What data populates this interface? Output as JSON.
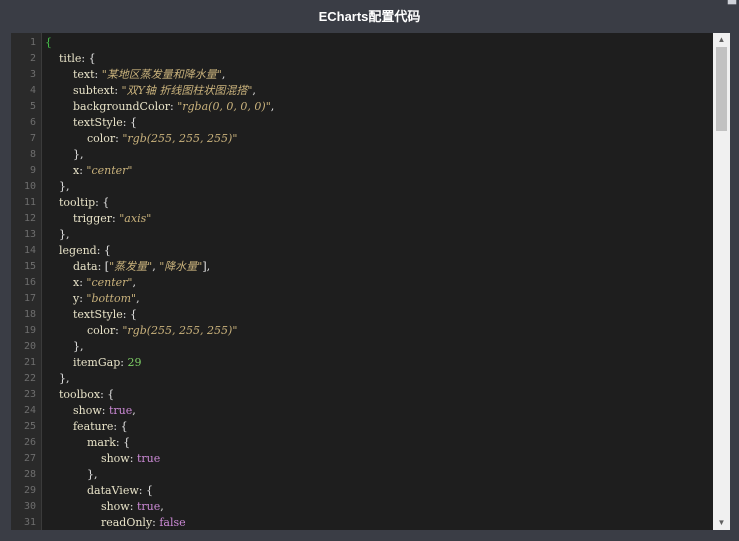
{
  "window": {
    "title": "ECharts配置代码",
    "close_glyph": "▀"
  },
  "editor": {
    "line_numbers": [
      "1",
      "2",
      "3",
      "4",
      "5",
      "6",
      "7",
      "8",
      "9",
      "10",
      "11",
      "12",
      "13",
      "14",
      "15",
      "16",
      "17",
      "18",
      "19",
      "20",
      "21",
      "22",
      "23",
      "24",
      "25",
      "26",
      "27",
      "28",
      "29",
      "30",
      "31"
    ],
    "lines": [
      [
        [
          "{",
          "brace0"
        ]
      ],
      [
        [
          "    ",
          ""
        ],
        [
          "title",
          "key"
        ],
        [
          ": {",
          "punc"
        ]
      ],
      [
        [
          "        ",
          ""
        ],
        [
          "text",
          "key"
        ],
        [
          ": ",
          "punc"
        ],
        [
          "\"某地区蒸发量和降水量\"",
          "str"
        ],
        [
          ",",
          "punc"
        ]
      ],
      [
        [
          "        ",
          ""
        ],
        [
          "subtext",
          "key"
        ],
        [
          ": ",
          "punc"
        ],
        [
          "\"双Y轴 折线图柱状图混搭\"",
          "str"
        ],
        [
          ",",
          "punc"
        ]
      ],
      [
        [
          "        ",
          ""
        ],
        [
          "backgroundColor",
          "key"
        ],
        [
          ": ",
          "punc"
        ],
        [
          "\"rgba(0, 0, 0, 0)\"",
          "str"
        ],
        [
          ",",
          "punc"
        ]
      ],
      [
        [
          "        ",
          ""
        ],
        [
          "textStyle",
          "key"
        ],
        [
          ": {",
          "punc"
        ]
      ],
      [
        [
          "            ",
          ""
        ],
        [
          "color",
          "key"
        ],
        [
          ": ",
          "punc"
        ],
        [
          "\"rgb(255, 255, 255)\"",
          "str"
        ]
      ],
      [
        [
          "        },",
          "punc"
        ]
      ],
      [
        [
          "        ",
          ""
        ],
        [
          "x",
          "key"
        ],
        [
          ": ",
          "punc"
        ],
        [
          "\"center\"",
          "str"
        ]
      ],
      [
        [
          "    },",
          "punc"
        ]
      ],
      [
        [
          "    ",
          ""
        ],
        [
          "tooltip",
          "key"
        ],
        [
          ": {",
          "punc"
        ]
      ],
      [
        [
          "        ",
          ""
        ],
        [
          "trigger",
          "key"
        ],
        [
          ": ",
          "punc"
        ],
        [
          "\"axis\"",
          "str"
        ]
      ],
      [
        [
          "    },",
          "punc"
        ]
      ],
      [
        [
          "    ",
          ""
        ],
        [
          "legend",
          "key"
        ],
        [
          ": {",
          "punc"
        ]
      ],
      [
        [
          "        ",
          ""
        ],
        [
          "data",
          "key"
        ],
        [
          ": [",
          "punc"
        ],
        [
          "\"蒸发量\"",
          "str"
        ],
        [
          ", ",
          "punc"
        ],
        [
          "\"降水量\"",
          "str"
        ],
        [
          "],",
          "punc"
        ]
      ],
      [
        [
          "        ",
          ""
        ],
        [
          "x",
          "key"
        ],
        [
          ": ",
          "punc"
        ],
        [
          "\"center\"",
          "str"
        ],
        [
          ",",
          "punc"
        ]
      ],
      [
        [
          "        ",
          ""
        ],
        [
          "y",
          "key"
        ],
        [
          ": ",
          "punc"
        ],
        [
          "\"bottom\"",
          "str"
        ],
        [
          ",",
          "punc"
        ]
      ],
      [
        [
          "        ",
          ""
        ],
        [
          "textStyle",
          "key"
        ],
        [
          ": {",
          "punc"
        ]
      ],
      [
        [
          "            ",
          ""
        ],
        [
          "color",
          "key"
        ],
        [
          ": ",
          "punc"
        ],
        [
          "\"rgb(255, 255, 255)\"",
          "str"
        ]
      ],
      [
        [
          "        },",
          "punc"
        ]
      ],
      [
        [
          "        ",
          ""
        ],
        [
          "itemGap",
          "key"
        ],
        [
          ": ",
          "punc"
        ],
        [
          "29",
          "num"
        ]
      ],
      [
        [
          "    },",
          "punc"
        ]
      ],
      [
        [
          "    ",
          ""
        ],
        [
          "toolbox",
          "key"
        ],
        [
          ": {",
          "punc"
        ]
      ],
      [
        [
          "        ",
          ""
        ],
        [
          "show",
          "key"
        ],
        [
          ": ",
          "punc"
        ],
        [
          "true",
          "bool"
        ],
        [
          ",",
          "punc"
        ]
      ],
      [
        [
          "        ",
          ""
        ],
        [
          "feature",
          "key"
        ],
        [
          ": {",
          "punc"
        ]
      ],
      [
        [
          "            ",
          ""
        ],
        [
          "mark",
          "key"
        ],
        [
          ": {",
          "punc"
        ]
      ],
      [
        [
          "                ",
          ""
        ],
        [
          "show",
          "key"
        ],
        [
          ": ",
          "punc"
        ],
        [
          "true",
          "bool"
        ]
      ],
      [
        [
          "            },",
          "punc"
        ]
      ],
      [
        [
          "            ",
          ""
        ],
        [
          "dataView",
          "key"
        ],
        [
          ": {",
          "punc"
        ]
      ],
      [
        [
          "                ",
          ""
        ],
        [
          "show",
          "key"
        ],
        [
          ": ",
          "punc"
        ],
        [
          "true",
          "bool"
        ],
        [
          ",",
          "punc"
        ]
      ],
      [
        [
          "                ",
          ""
        ],
        [
          "readOnly",
          "key"
        ],
        [
          ": ",
          "punc"
        ],
        [
          "false",
          "bool"
        ]
      ]
    ]
  },
  "scrollbar": {
    "up_glyph": "▲",
    "down_glyph": "▼",
    "position_fraction": 0.0,
    "visible_fraction": 0.18
  },
  "colors": {
    "titlebar_bg": "#3a3d45",
    "editor_bg": "#1e1e1e",
    "key": "#e8e3c8",
    "string": "#c9b27c",
    "number": "#7ecf66",
    "boolean": "#cc8ad6"
  }
}
